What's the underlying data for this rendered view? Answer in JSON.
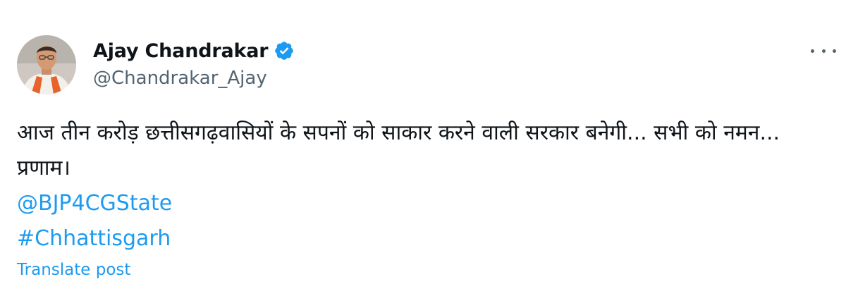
{
  "post": {
    "author": {
      "display_name": "Ajay Chandrakar",
      "handle": "@Chandrakar_Ajay",
      "verified": true,
      "avatar_icon": "profile-photo"
    },
    "more_icon": "ellipsis-icon",
    "text": "आज तीन करोड़ छत्तीसगढ़वासियों के सपनों को साकार करने वाली सरकार बनेगी... सभी को नमन... प्रणाम।",
    "mentions": [
      "@BJP4CGState"
    ],
    "hashtags": [
      "#Chhattisgarh"
    ],
    "translate_label": "Translate post"
  },
  "colors": {
    "link": "#1d9bf0",
    "secondary_text": "#536471",
    "primary_text": "#0f1419",
    "verified_badge": "#1d9bf0"
  }
}
